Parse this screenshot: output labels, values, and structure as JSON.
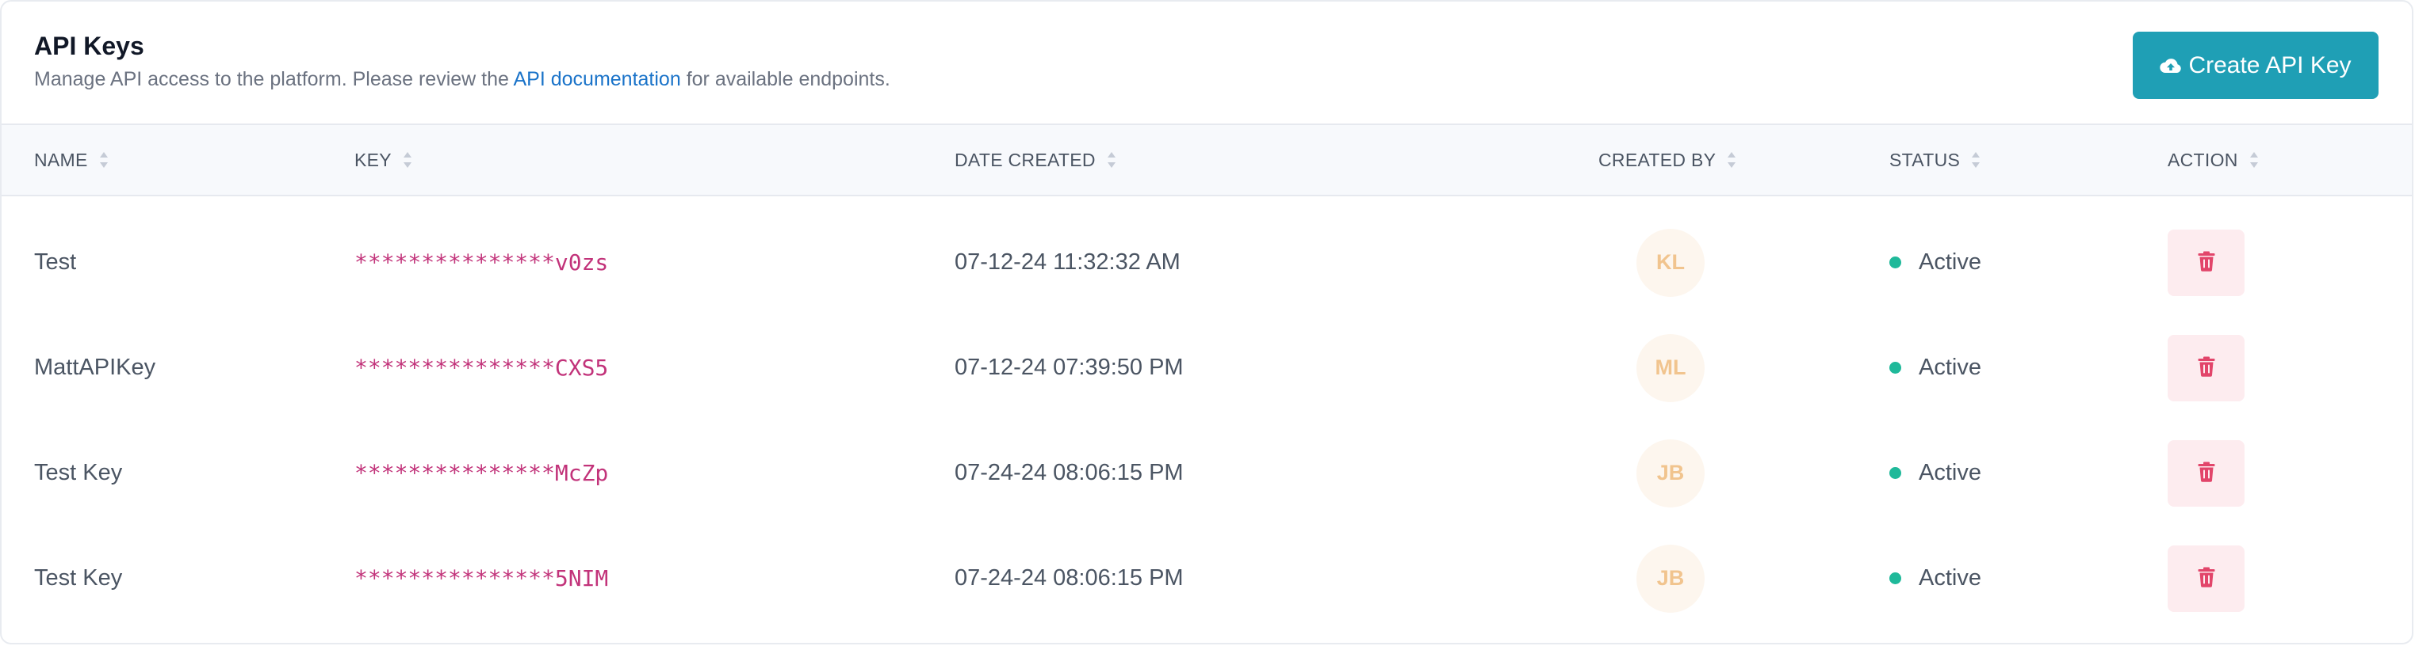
{
  "header": {
    "title": "API Keys",
    "subtitle_before": "Manage API access to the platform. Please review the ",
    "subtitle_link": "API documentation",
    "subtitle_after": " for available endpoints.",
    "create_button_label": "Create API Key"
  },
  "columns": [
    {
      "label": "NAME"
    },
    {
      "label": "KEY"
    },
    {
      "label": "DATE CREATED"
    },
    {
      "label": "CREATED BY"
    },
    {
      "label": "STATUS"
    },
    {
      "label": "ACTION"
    }
  ],
  "rows": [
    {
      "name": "Test",
      "key": "***************v0zs",
      "date_created": "07-12-24 11:32:32 AM",
      "created_by": "KL",
      "status": "Active"
    },
    {
      "name": "MattAPIKey",
      "key": "***************CXS5",
      "date_created": "07-12-24 07:39:50 PM",
      "created_by": "ML",
      "status": "Active"
    },
    {
      "name": "Test Key",
      "key": "***************McZp",
      "date_created": "07-24-24 08:06:15 PM",
      "created_by": "JB",
      "status": "Active"
    },
    {
      "name": "Test Key",
      "key": "***************5NIM",
      "date_created": "07-24-24 08:06:15 PM",
      "created_by": "JB",
      "status": "Active"
    }
  ],
  "icons": {
    "create_button": "cloud-upload-icon",
    "sort": "sort-icon",
    "delete": "trash-icon",
    "status": "status-dot-icon"
  },
  "colors": {
    "accent": "#1f9fb5",
    "link": "#1a73c9",
    "key_text": "#c2337a",
    "status_active": "#1fb99a",
    "delete_icon": "#e2456a",
    "delete_bg": "#fdecef",
    "avatar_bg": "#fdf6ee",
    "avatar_text": "#f1c48e"
  }
}
